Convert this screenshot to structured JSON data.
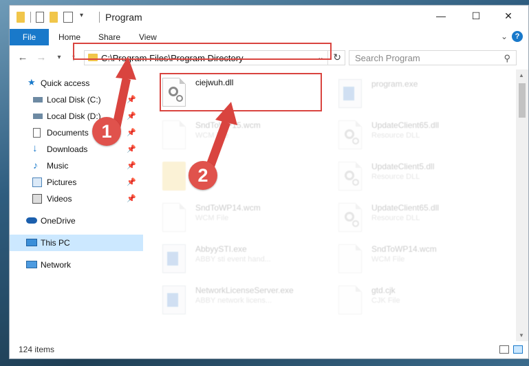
{
  "window": {
    "title": "Program"
  },
  "ribbon": {
    "file_tab": "File",
    "tabs": [
      "Home",
      "Share",
      "View"
    ]
  },
  "navigation": {
    "address_path": "C:\\Program Files\\Program Directory",
    "search_placeholder": "Search Program"
  },
  "sidebar": {
    "items": [
      {
        "label": "Quick access",
        "icon": "star-icon",
        "pinned": false
      },
      {
        "label": "Local Disk (C:)",
        "icon": "drive-icon",
        "pinned": true
      },
      {
        "label": "Local Disk (D:)",
        "icon": "drive-icon",
        "pinned": true
      },
      {
        "label": "Documents",
        "icon": "documents-icon",
        "pinned": true
      },
      {
        "label": "Downloads",
        "icon": "downloads-icon",
        "pinned": true
      },
      {
        "label": "Music",
        "icon": "music-icon",
        "pinned": true
      },
      {
        "label": "Pictures",
        "icon": "pictures-icon",
        "pinned": true
      },
      {
        "label": "Videos",
        "icon": "videos-icon",
        "pinned": true
      },
      {
        "label": "OneDrive",
        "icon": "cloud-icon",
        "pinned": false
      },
      {
        "label": "This PC",
        "icon": "pc-icon",
        "pinned": false
      },
      {
        "label": "Network",
        "icon": "network-icon",
        "pinned": false
      }
    ]
  },
  "files": {
    "left": [
      {
        "name": "ciejwuh.dll",
        "type": "",
        "icon": "dll-icon"
      },
      {
        "name": "SndToWP15.wcm",
        "type": "WCM File",
        "icon": "doc-icon"
      },
      {
        "name": "",
        "type": "",
        "icon": "folder-icon"
      },
      {
        "name": "SndToWP14.wcm",
        "type": "WCM File",
        "icon": "doc-icon"
      },
      {
        "name": "AbbyySTI.exe",
        "type": "ABBY sti event hand...",
        "icon": "exe-icon"
      },
      {
        "name": "NetworkLicenseServer.exe",
        "type": "ABBY network licens...",
        "icon": "exe-icon"
      }
    ],
    "right": [
      {
        "name": "program.exe",
        "type": "",
        "icon": "exe-icon"
      },
      {
        "name": "UpdateClient65.dll",
        "type": "Resource DLL",
        "icon": "dll-icon"
      },
      {
        "name": "UpdateClient5.dll",
        "type": "Resource DLL",
        "icon": "dll-icon"
      },
      {
        "name": "UpdateClient65.dll",
        "type": "Resource DLL",
        "icon": "dll-icon"
      },
      {
        "name": "SndToWP14.wcm",
        "type": "WCM File",
        "icon": "doc-icon"
      },
      {
        "name": "gtd.cjk",
        "type": "CJK File",
        "icon": "doc-icon"
      }
    ]
  },
  "annotations": {
    "badge_1": "1",
    "badge_2": "2",
    "color": "#d9443f"
  },
  "status": {
    "item_count": "124 items"
  }
}
